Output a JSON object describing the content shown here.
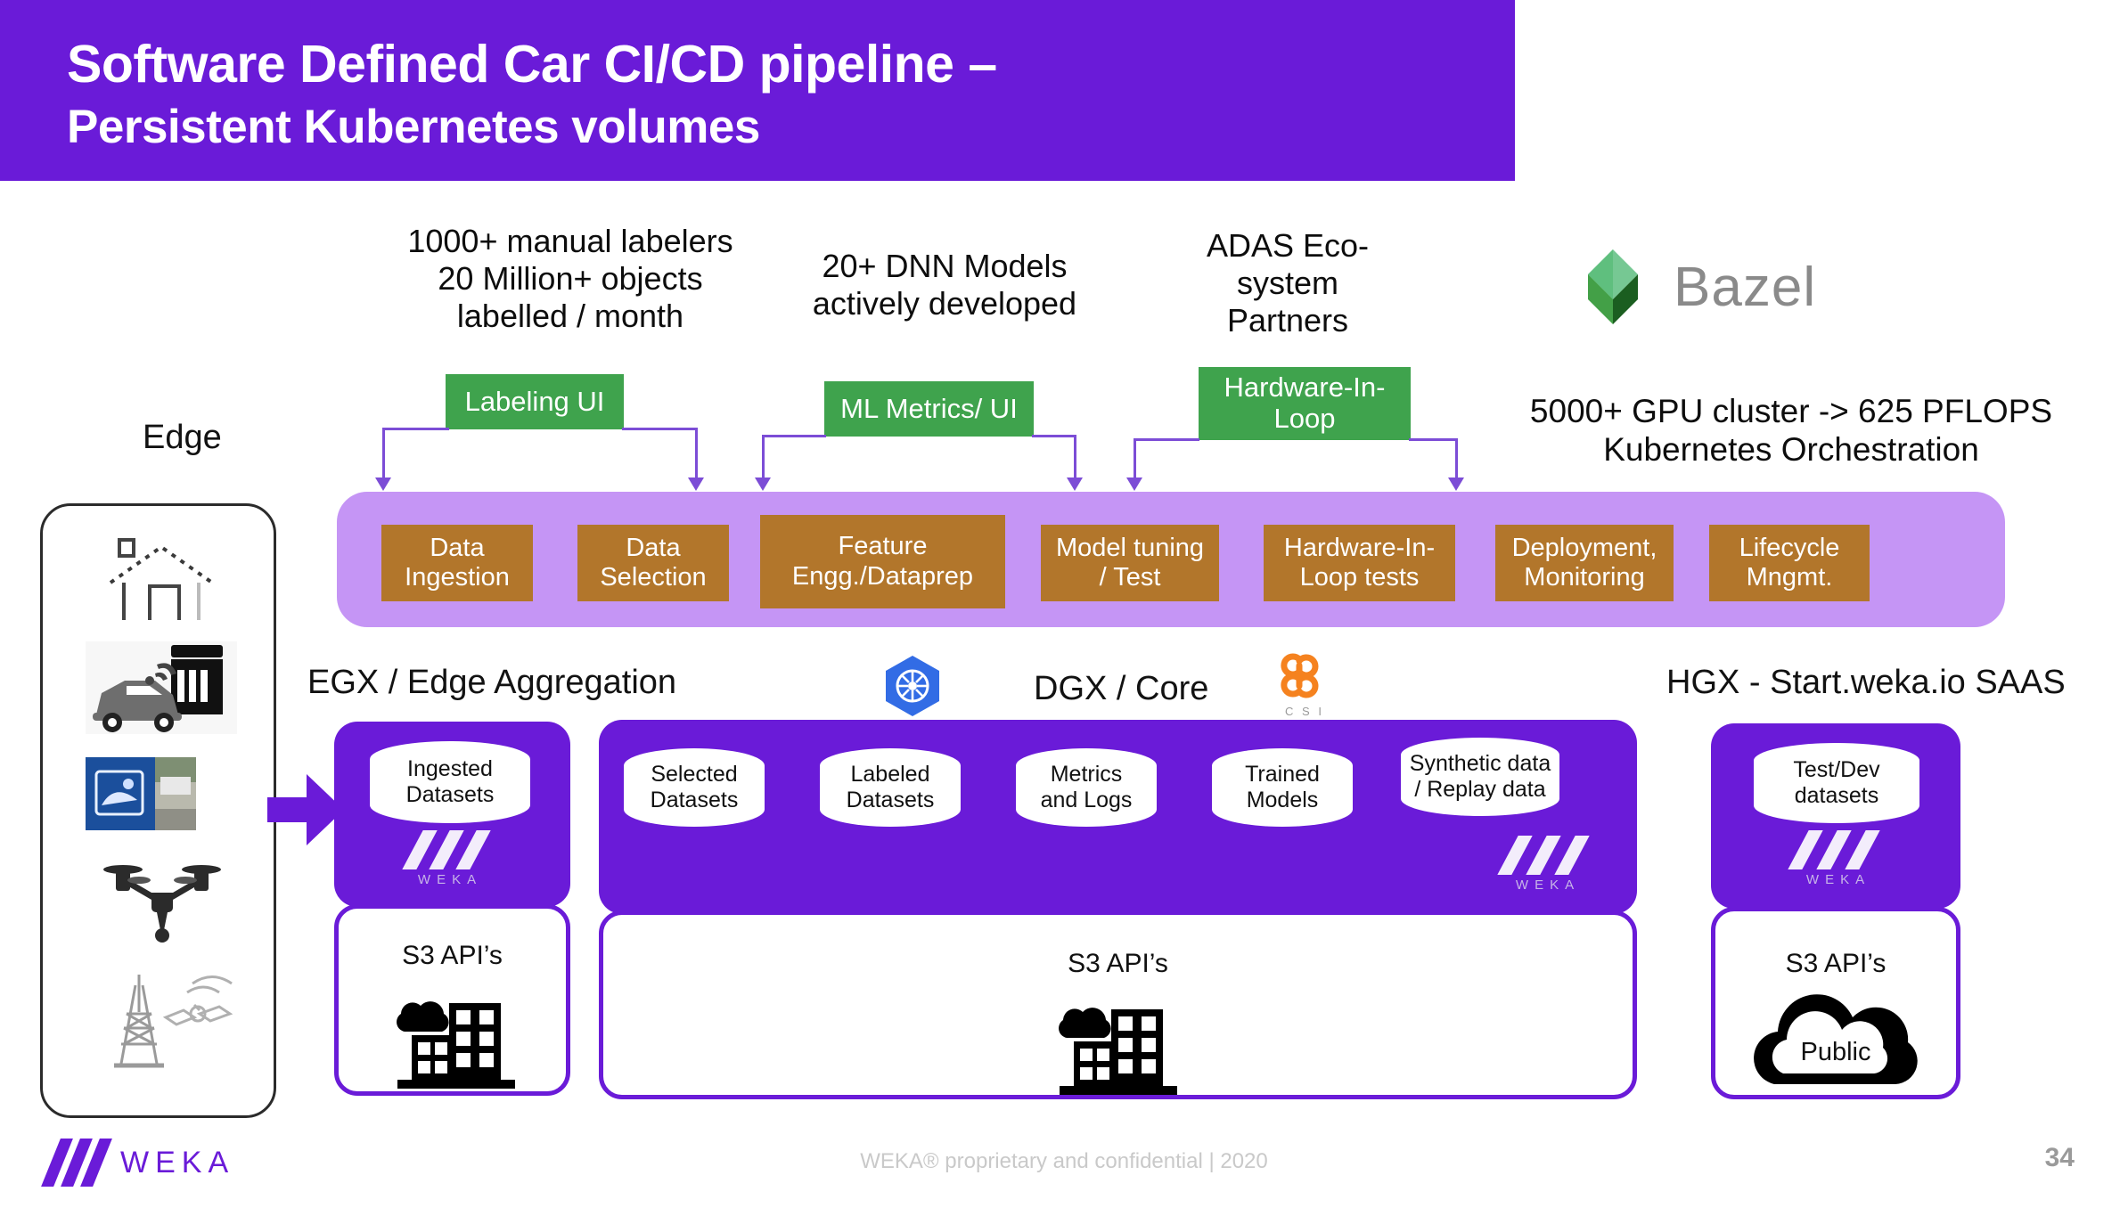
{
  "header": {
    "title_line1": "Software Defined Car CI/CD pipeline –",
    "title_line2": "Persistent Kubernetes volumes",
    "bg_color": "#6A1BD8"
  },
  "annotations": [
    {
      "id": "labelers",
      "text": "1000+ manual labelers\n20 Million+ objects\nlabelled / month"
    },
    {
      "id": "dnn-models",
      "text": "20+ DNN Models\nactively developed"
    },
    {
      "id": "adas-partners",
      "text": "ADAS Eco-\nsystem\nPartners"
    },
    {
      "id": "gpu-cluster",
      "text": "5000+ GPU cluster -> 625 PFLOPS\nKubernetes Orchestration"
    }
  ],
  "tools": [
    {
      "name": "Labeling UI",
      "color": "#3FA34D"
    },
    {
      "name": "ML Metrics/ UI",
      "color": "#3FA34D"
    },
    {
      "name": "Hardware-In-\nLoop",
      "color": "#3FA34D"
    }
  ],
  "logos": {
    "bazel_name": "Bazel",
    "kubernetes": "kubernetes-icon",
    "csi": "csi-icon",
    "csi_label": "C S I",
    "weka_wordmark": "WEKA",
    "weka_watermark": "WEKA"
  },
  "pipeline": {
    "band_color": "#C595F5",
    "stage_color": "#B2762B",
    "stages": [
      {
        "label": "Data\nIngestion"
      },
      {
        "label": "Data\nSelection"
      },
      {
        "label": "Feature\nEngg./Dataprep"
      },
      {
        "label": "Model tuning\n/ Test"
      },
      {
        "label": "Hardware-In-\nLoop tests"
      },
      {
        "label": "Deployment,\nMonitoring"
      },
      {
        "label": "Lifecycle\nMngmt."
      }
    ]
  },
  "sections": {
    "edge_label": "Edge",
    "egx": "EGX / Edge Aggregation",
    "dgx": "DGX / Core",
    "hgx": "HGX - Start.weka.io SAAS"
  },
  "storage": {
    "panel_color": "#6A1BD8",
    "s3_label": "S3 API’s",
    "public_label": "Public",
    "edge": {
      "datasets": [
        {
          "label": "Ingested\nDatasets"
        }
      ]
    },
    "core": {
      "datasets": [
        {
          "label": "Selected\nDatasets"
        },
        {
          "label": "Labeled\nDatasets"
        },
        {
          "label": "Metrics\nand Logs"
        },
        {
          "label": "Trained\nModels"
        },
        {
          "label": "Synthetic data\n/ Replay data"
        }
      ]
    },
    "cloud": {
      "datasets": [
        {
          "label": "Test/Dev\ndatasets"
        }
      ]
    }
  },
  "edge_devices": [
    {
      "icon": "smart-home-icon"
    },
    {
      "icon": "connected-car-icon"
    },
    {
      "icon": "roadside-camera-icon"
    },
    {
      "icon": "drone-icon"
    },
    {
      "icon": "cell-tower-satellite-icon"
    }
  ],
  "footer": {
    "note": "WEKA® proprietary and confidential  |  2020",
    "page_number": "34"
  }
}
